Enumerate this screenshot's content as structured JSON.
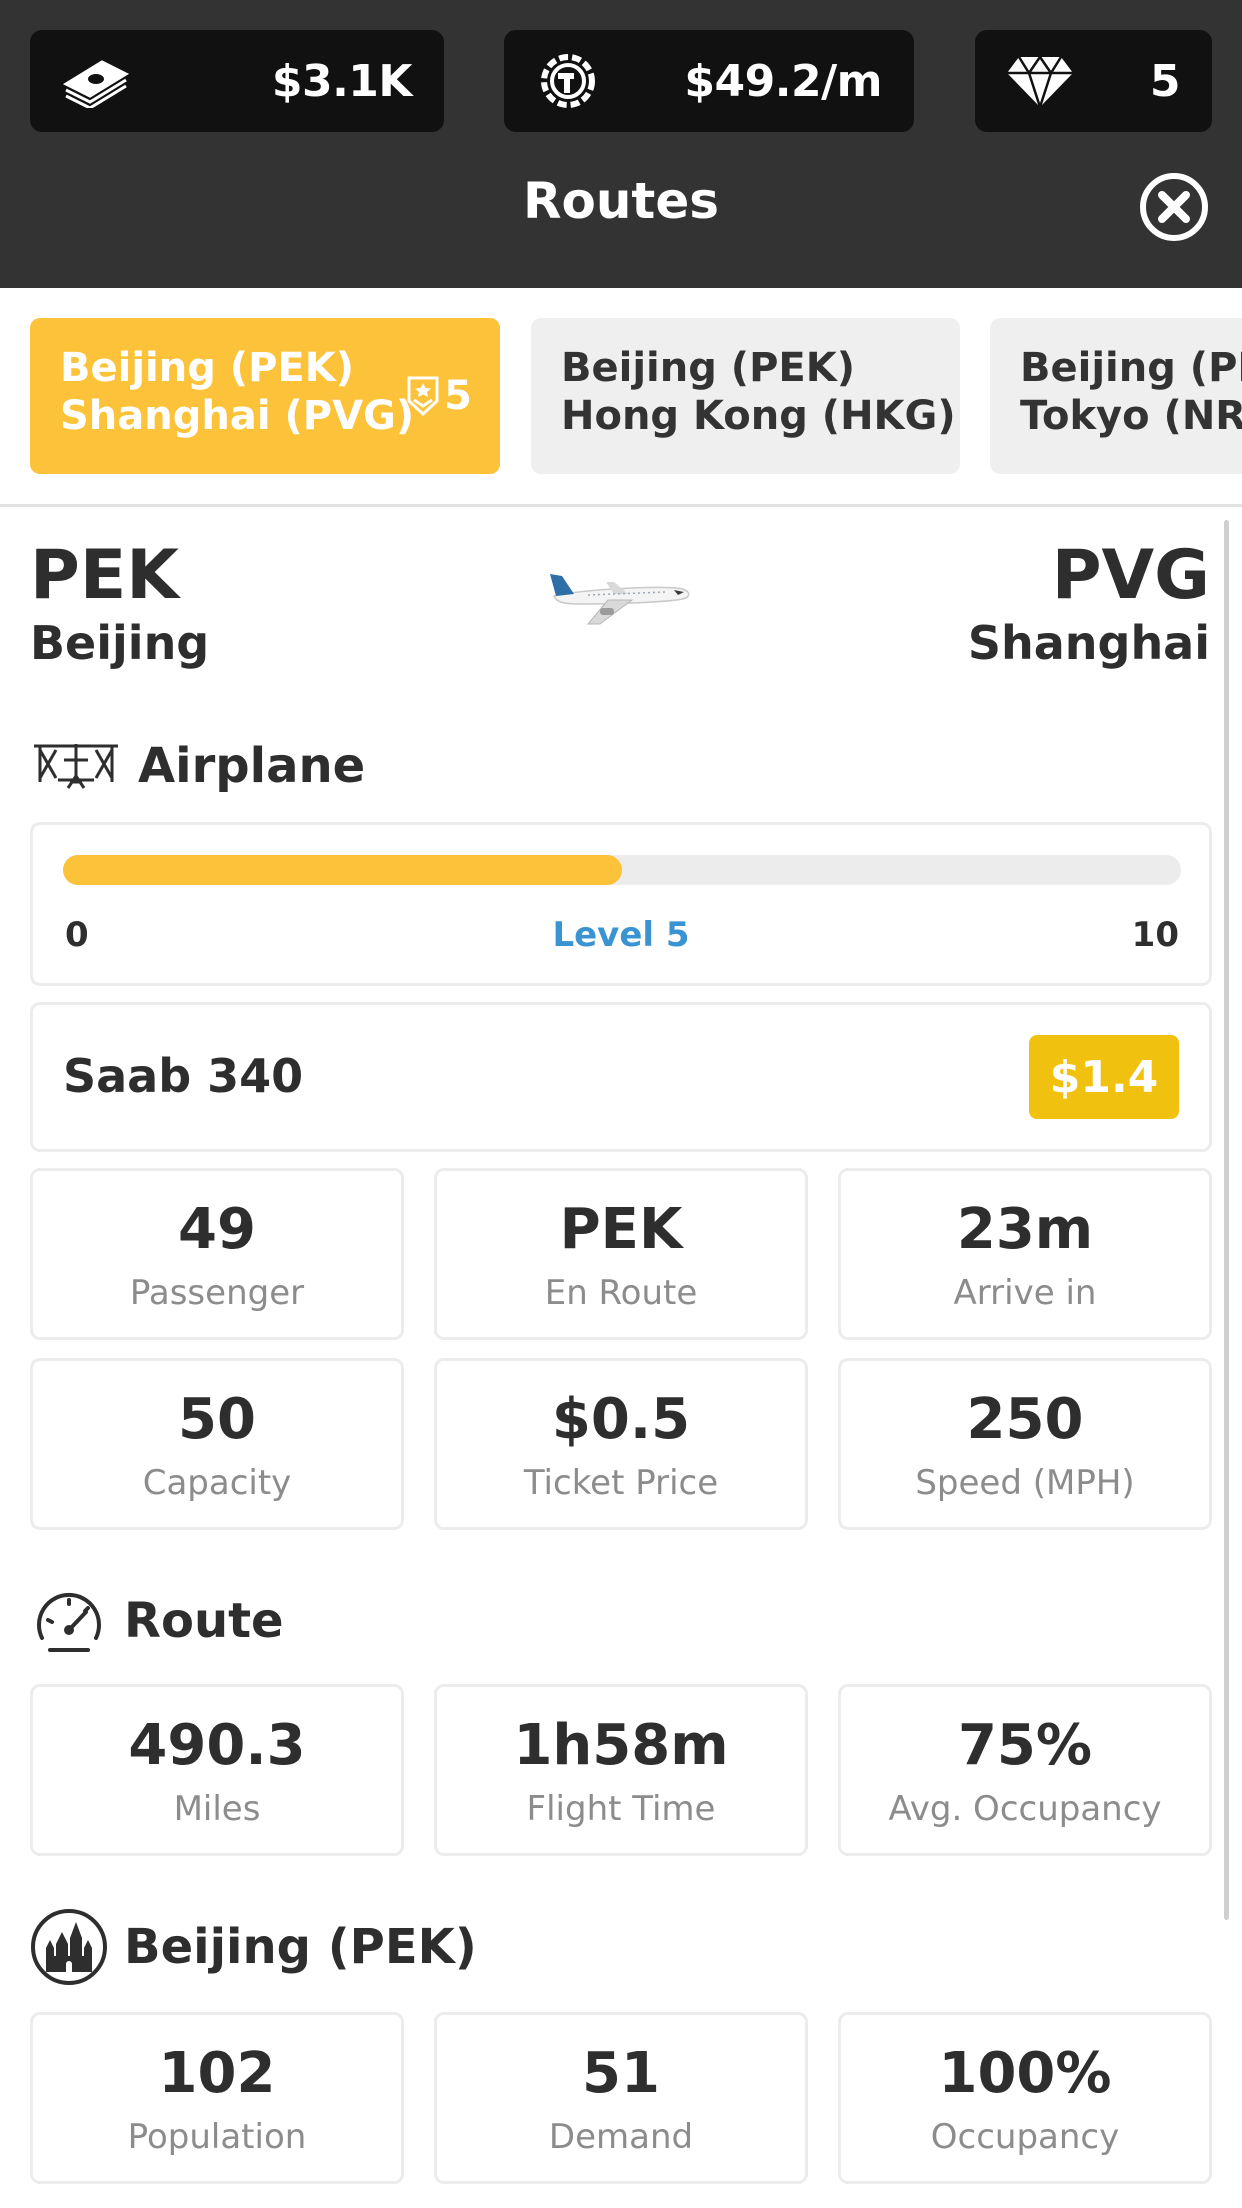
{
  "header": {
    "money": "$3.1K",
    "rate": "$49.2/m",
    "gems": "5",
    "title": "Routes",
    "icons": [
      "money-stack-icon",
      "gear-hammer-icon",
      "diamond-icon",
      "close-circle-icon"
    ]
  },
  "tabs": [
    {
      "line1": "Beijing (PEK)",
      "line2": "Shanghai (PVG)",
      "badge": "5",
      "active": true
    },
    {
      "line1": "Beijing (PEK)",
      "line2": "Hong Kong (HKG)",
      "active": false
    },
    {
      "line1": "Beijing (PEK)",
      "line2": "Tokyo (NRT)",
      "active": false
    }
  ],
  "route": {
    "from_code": "PEK",
    "from_city": "Beijing",
    "to_code": "PVG",
    "to_city": "Shanghai"
  },
  "airplane": {
    "section_title": "Airplane",
    "level_min": "0",
    "level_label": "Level 5",
    "level_max": "10",
    "level_fraction": 0.5,
    "model": "Saab 340",
    "upgrade_price": "$1.4",
    "stats": [
      {
        "value": "49",
        "label": "Passenger"
      },
      {
        "value": "PEK",
        "label": "En Route"
      },
      {
        "value": "23m",
        "label": "Arrive in"
      },
      {
        "value": "50",
        "label": "Capacity"
      },
      {
        "value": "$0.5",
        "label": "Ticket Price"
      },
      {
        "value": "250",
        "label": "Speed (MPH)"
      }
    ]
  },
  "route_stats": {
    "section_title": "Route",
    "stats": [
      {
        "value": "490.3",
        "label": "Miles"
      },
      {
        "value": "1h58m",
        "label": "Flight Time"
      },
      {
        "value": "75%",
        "label": "Avg. Occupancy"
      }
    ]
  },
  "origin_city": {
    "section_title": "Beijing (PEK)",
    "stats": [
      {
        "value": "102",
        "label": "Population"
      },
      {
        "value": "51",
        "label": "Demand"
      },
      {
        "value": "100%",
        "label": "Occupancy"
      }
    ]
  },
  "colors": {
    "accent": "#fcc23a",
    "level_text": "#3a94d2",
    "price_button": "#f0c20f",
    "header_bg": "#333333"
  }
}
